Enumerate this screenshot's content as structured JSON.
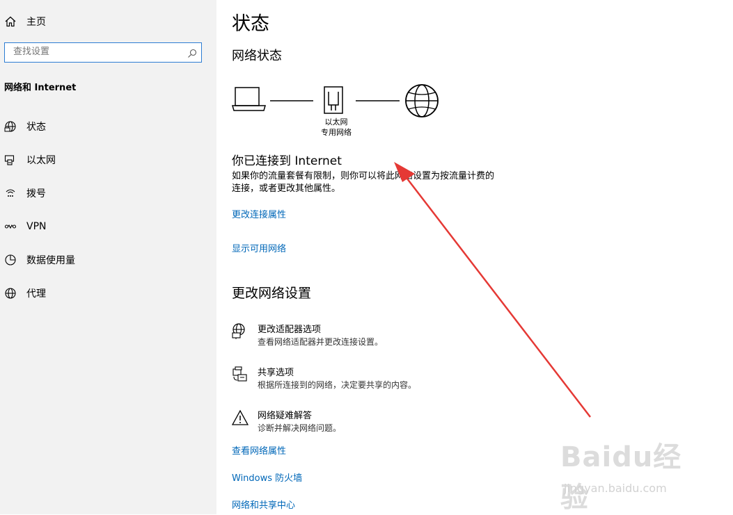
{
  "sidebar": {
    "home_label": "主页",
    "search_placeholder": "查找设置",
    "section_title": "网络和 Internet",
    "items": [
      {
        "label": "状态",
        "icon": "globe-icon"
      },
      {
        "label": "以太网",
        "icon": "ethernet-icon"
      },
      {
        "label": "拨号",
        "icon": "dialup-icon"
      },
      {
        "label": "VPN",
        "icon": "vpn-icon"
      },
      {
        "label": "数据使用量",
        "icon": "data-usage-icon"
      },
      {
        "label": "代理",
        "icon": "globe-icon"
      }
    ]
  },
  "main": {
    "title": "状态",
    "network_status_heading": "网络状态",
    "diagram": {
      "caption_line1": "以太网",
      "caption_line2": "专用网络"
    },
    "connected_text": "你已连接到 Internet",
    "description": "如果你的流量套餐有限制，则你可以将此网络设置为按流量计费的连接，或者更改其他属性。",
    "description_line1": "如果你的流量套餐有限制，则你可以将此网络设置为按流量计费的",
    "description_line2": "连接，或者更改其他属性。",
    "links_top": [
      "更改连接属性",
      "显示可用网络"
    ],
    "change_heading": "更改网络设置",
    "settings": [
      {
        "title": "更改适配器选项",
        "desc": "查看网络适配器并更改连接设置。",
        "icon": "adapter-icon"
      },
      {
        "title": "共享选项",
        "desc": "根据所连接到的网络，决定要共享的内容。",
        "icon": "sharing-icon"
      },
      {
        "title": "网络疑难解答",
        "desc": "诊断并解决网络问题。",
        "icon": "warning-icon"
      }
    ],
    "links_bottom": [
      "查看网络属性",
      "Windows 防火墙",
      "网络和共享中心"
    ]
  },
  "watermark": {
    "logo": "Baidu经验",
    "site": "jingyan.baidu.com"
  },
  "colors": {
    "link": "#0067b8",
    "sidebar_bg": "#f2f2f2",
    "search_border": "#2b7cd3",
    "arrow": "#e53935"
  }
}
